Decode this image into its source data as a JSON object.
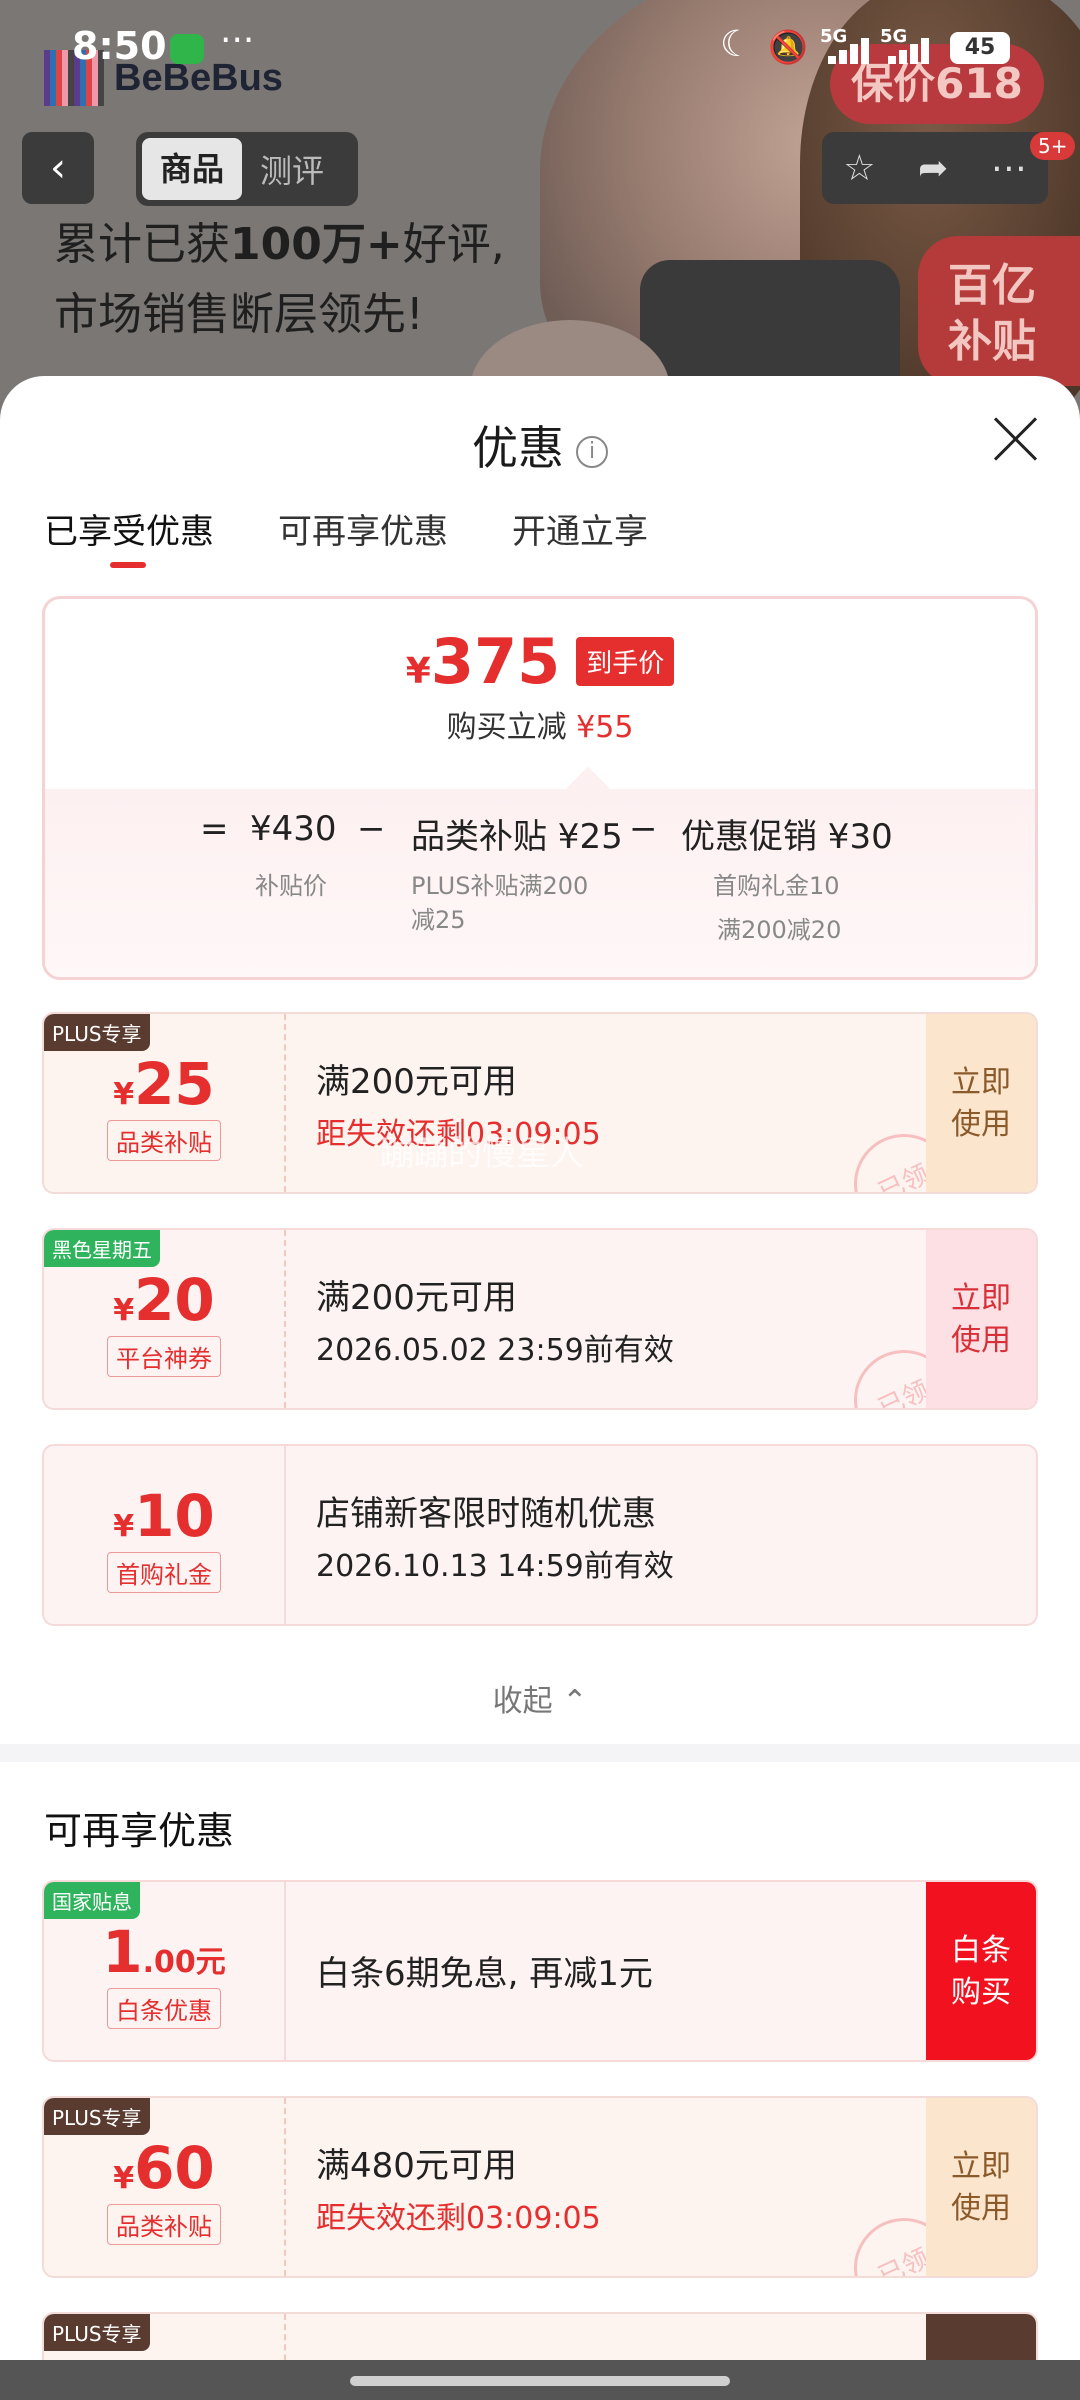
{
  "status_bar": {
    "time": "8:50",
    "more": "···",
    "sig1": "5G",
    "sig2": "5G",
    "battery": "45"
  },
  "background": {
    "brand": "BeBeBus",
    "baojia": "保价618",
    "tabs": [
      "商品",
      "测评"
    ],
    "badge": "5+",
    "headline_a": "累计已获",
    "headline_b": "100万+",
    "headline_c": "好评,",
    "headline_2": "市场销售断层领先!",
    "yibai_1": "百亿",
    "yibai_2": "补贴"
  },
  "sheet": {
    "title": "优惠",
    "tabs": [
      "已享受优惠",
      "可再享优惠",
      "开通立享"
    ]
  },
  "summary": {
    "price_symbol": "¥",
    "price": "375",
    "tag": "到手价",
    "reduce_label": "购买立减",
    "reduce_value": "¥55",
    "eq": "=",
    "base": "¥430",
    "base_label": "补贴价",
    "minus": "−",
    "item1": "品类补贴 ¥25",
    "item1_sub1": "PLUS补贴满200",
    "item1_sub2": "减25",
    "item2": "优惠促销 ¥30",
    "item2_sub1": "首购礼金10",
    "item2_sub2": "满200减20"
  },
  "coupons": [
    {
      "ribbon": "PLUS专享",
      "symbol": "¥",
      "amount": "25",
      "label": "品类补贴",
      "cond": "满200元可用",
      "expire": "距失效还剩03:09:05",
      "action1": "立即",
      "action2": "使用",
      "stamp": "已领"
    },
    {
      "ribbon": "黑色星期五",
      "symbol": "¥",
      "amount": "20",
      "label": "平台神券",
      "cond": "满200元可用",
      "expire": "2026.05.02 23:59前有效",
      "action1": "立即",
      "action2": "使用",
      "stamp": "已领"
    },
    {
      "symbol": "¥",
      "amount": "10",
      "label": "首购礼金",
      "cond": "店铺新客限时随机优惠",
      "expire": "2026.10.13 14:59前有效"
    }
  ],
  "watermark": "蹦蹦的慢星人",
  "collapse": "收起 ⌃",
  "more_section": {
    "title": "可再享优惠"
  },
  "more_coupons": [
    {
      "ribbon": "国家贴息",
      "amount": "1",
      "cents": ".00元",
      "label": "白条优惠",
      "cond": "白条6期免息, 再减1元",
      "action1": "白条",
      "action2": "购买"
    },
    {
      "ribbon": "PLUS专享",
      "symbol": "¥",
      "amount": "60",
      "label": "品类补贴",
      "cond": "满480元可用",
      "expire": "距失效还剩03:09:05",
      "action1": "立即",
      "action2": "使用",
      "stamp": "已领"
    },
    {
      "ribbon": "PLUS专享"
    }
  ]
}
